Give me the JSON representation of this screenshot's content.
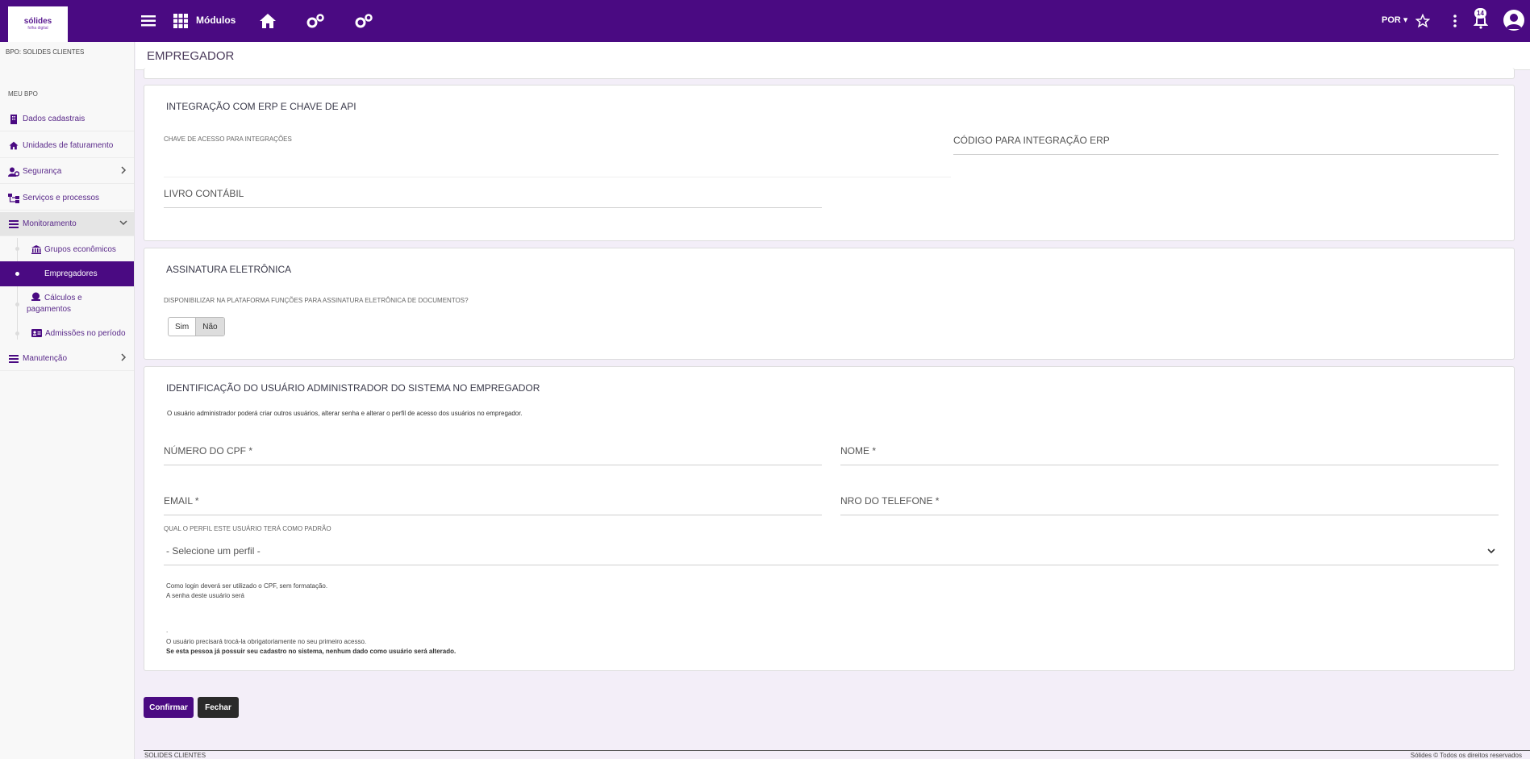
{
  "header": {
    "logo_line1": "sólides",
    "logo_line2": "folha digital",
    "modules_label": "Módulos",
    "language": "POR",
    "notification_count": "14"
  },
  "sidebar": {
    "tenant": "BPO: SOLIDES CLIENTES",
    "section": "MEU BPO",
    "items": [
      {
        "label": "Dados cadastrais"
      },
      {
        "label": "Unidades de faturamento"
      },
      {
        "label": "Segurança"
      },
      {
        "label": "Serviços e processos"
      },
      {
        "label": "Monitoramento"
      },
      {
        "label": "Manutenção"
      }
    ],
    "subitems": [
      {
        "label": "Grupos econômicos"
      },
      {
        "label": "Empregadores"
      },
      {
        "label": "Cálculos e pagamentos"
      },
      {
        "label": "Admissões no período"
      }
    ]
  },
  "page": {
    "title": "EMPREGADOR"
  },
  "erp": {
    "title": "INTEGRAÇÃO COM ERP E CHAVE DE API",
    "api_key_label": "CHAVE DE ACESSO PARA INTEGRAÇÕES",
    "erp_code_label": "CÓDIGO PARA INTEGRAÇÃO ERP",
    "ledger_label": "LIVRO CONTÁBIL"
  },
  "esign": {
    "title": "ASSINATURA ELETRÔNICA",
    "question": "DISPONIBILIZAR NA PLATAFORMA FUNÇÕES PARA ASSINATURA ELETRÔNICA DE DOCUMENTOS?",
    "yes": "Sim",
    "no": "Não",
    "selected": "Não"
  },
  "admin": {
    "title": "IDENTIFICAÇÃO DO USUÁRIO ADMINISTRADOR DO SISTEMA NO EMPREGADOR",
    "description": "O usuário administrador poderá criar outros usuários, alterar senha e alterar o perfil de acesso dos usuários no empregador.",
    "cpf_label": "NÚMERO DO CPF *",
    "name_label": "NOME *",
    "email_label": "EMAIL *",
    "phone_label": "NRO DO TELEFONE *",
    "profile_question": "QUAL O PERFIL ESTE USUÁRIO TERÁ COMO PADRÃO",
    "profile_placeholder": "- Selecione um perfil -",
    "note1": "Como login deverá ser utilizado o CPF, sem formatação.",
    "note2": "A senha deste usuário será",
    "note3": ".",
    "note4": "O usuário precisará trocá-la obrigatoriamente no seu primeiro acesso.",
    "note5": "Se esta pessoa já possuir seu cadastro no sistema, nenhum dado como usuário será alterado."
  },
  "actions": {
    "confirm": "Confirmar",
    "close": "Fechar"
  },
  "footer": {
    "left": "SOLIDES CLIENTES",
    "right": "Sólides © Todos os direitos reservados"
  },
  "colors": {
    "brand": "#4a0a82",
    "dark_button": "#2a2a2a"
  }
}
